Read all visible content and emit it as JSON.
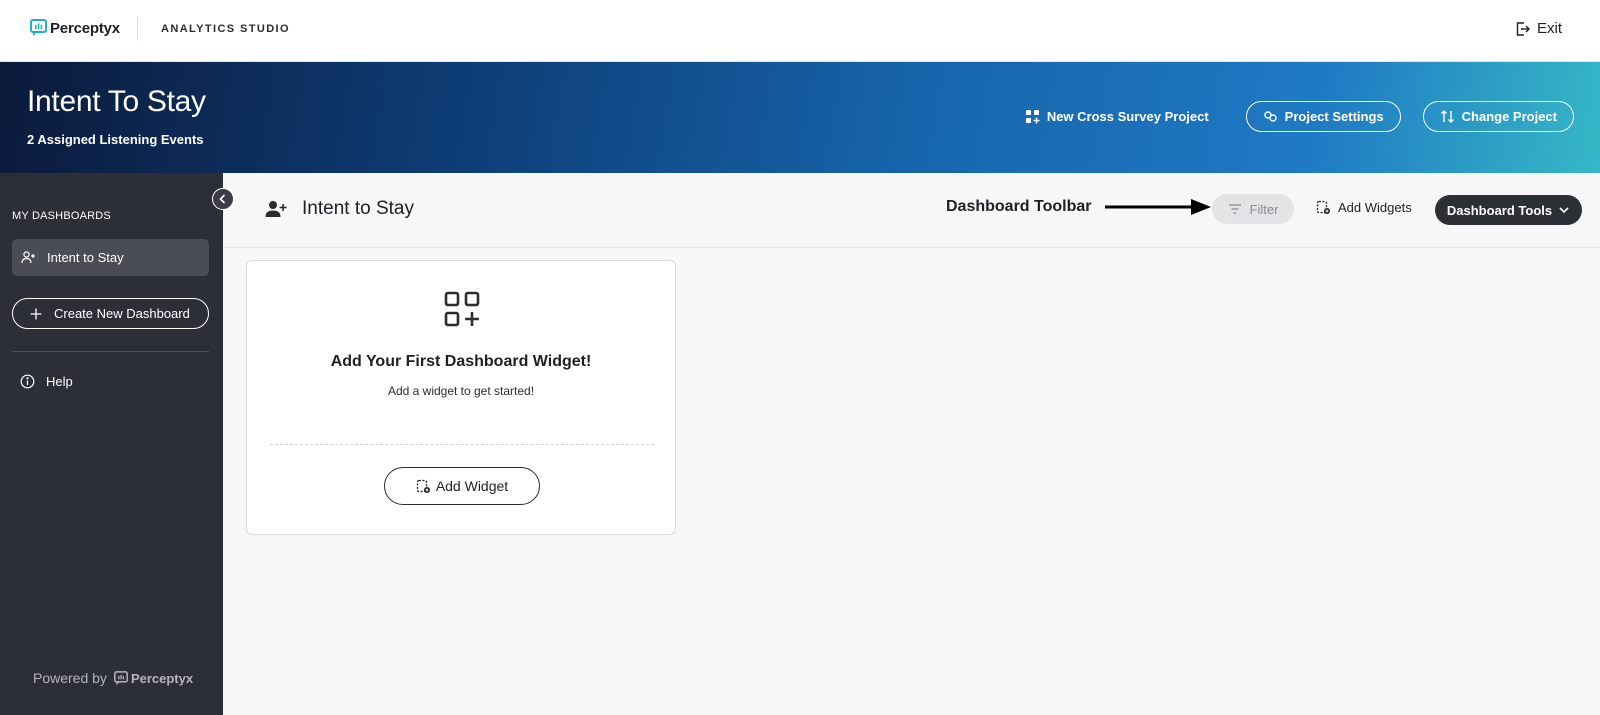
{
  "topnav": {
    "brand_name": "Perceptyx",
    "app_label": "ANALYTICS STUDIO",
    "exit_label": "Exit"
  },
  "project": {
    "title": "Intent To Stay",
    "subtitle": "2 Assigned Listening Events",
    "new_cross_survey_label": "New Cross Survey Project",
    "settings_label": "Project Settings",
    "change_label": "Change Project"
  },
  "sidebar": {
    "heading": "MY DASHBOARDS",
    "items": [
      {
        "label": "Intent to Stay",
        "active": true
      }
    ],
    "create_label": "Create New Dashboard",
    "help_label": "Help",
    "powered_by": "Powered by",
    "powered_brand": "Perceptyx"
  },
  "dashboard": {
    "title": "Intent to Stay",
    "annotation": "Dashboard Toolbar",
    "filter_label": "Filter",
    "add_widgets_label": "Add Widgets",
    "tools_label": "Dashboard Tools"
  },
  "empty_state": {
    "title": "Add Your First Dashboard Widget!",
    "subtitle": "Add a widget to get started!",
    "button_label": "Add Widget"
  },
  "colors": {
    "sidebar_bg": "#2c2f36",
    "header_gradient_start": "#0c1a3a",
    "header_gradient_end": "#36b8c6",
    "brand_teal": "#1bb3c4"
  },
  "icons": {
    "brand": "perceptyx-logo-icon",
    "exit": "exit-icon",
    "new_project": "grid-plus-icon",
    "settings": "link-settings-icon",
    "change": "swap-icon",
    "collapse": "chevron-left-icon",
    "user": "user-plus-icon",
    "create": "plus-icon",
    "help": "info-icon",
    "filter": "filter-icon",
    "add_widget": "widget-add-icon",
    "dropdown": "chevron-down-icon"
  }
}
